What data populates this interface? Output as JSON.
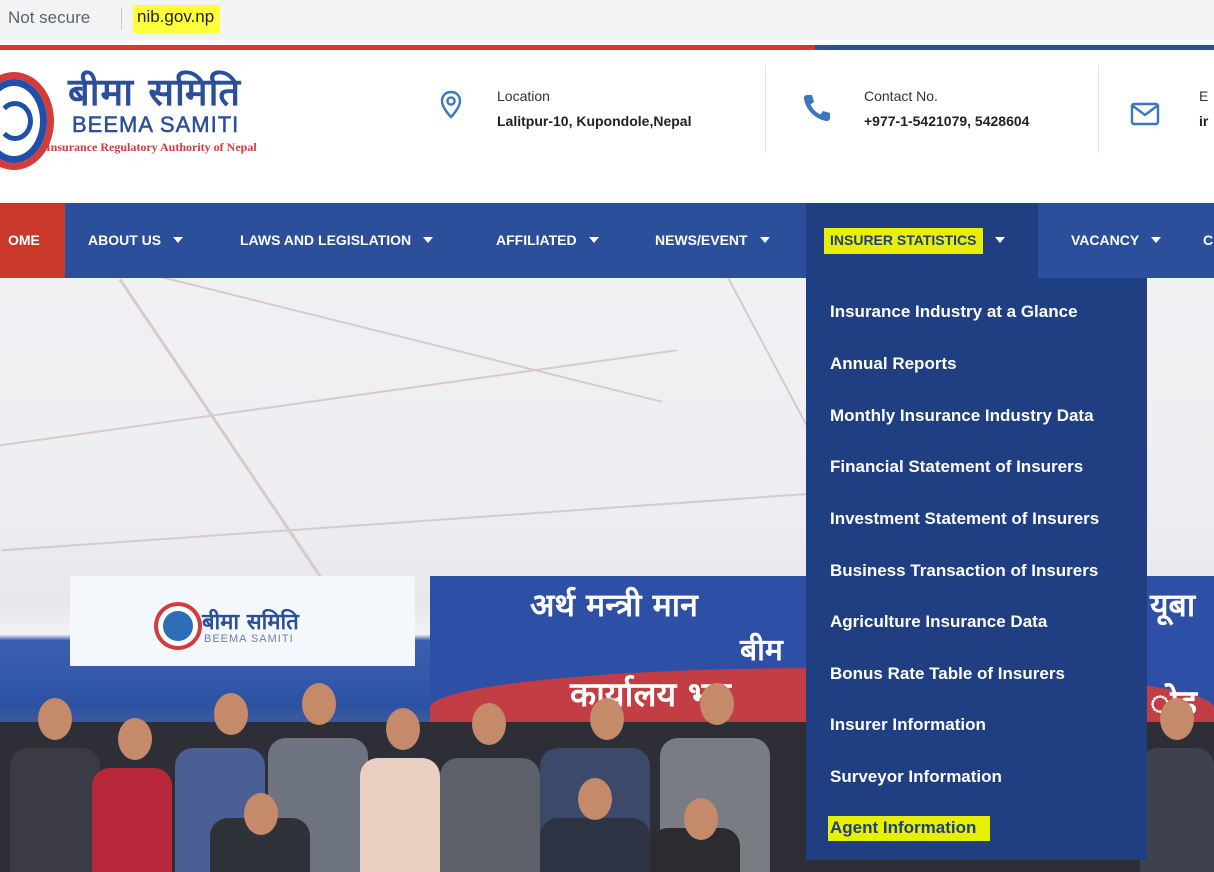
{
  "browser": {
    "security_label": "Not secure",
    "url": "nib.gov.np"
  },
  "header": {
    "logo": {
      "devanagari": "बीमा समिति",
      "latin": "BEEMA SAMITI",
      "tagline": "Insurance Regulatory Authority of Nepal"
    },
    "location": {
      "label": "Location",
      "value": "Lalitpur-10, Kupondole,Nepal"
    },
    "contact": {
      "label": "Contact No.",
      "value": "+977-1-5421079, 5428604"
    },
    "email": {
      "label": "E",
      "value": "ir"
    }
  },
  "nav": {
    "items": [
      {
        "label": "OME"
      },
      {
        "label": "ABOUT US"
      },
      {
        "label": "LAWS AND LEGISLATION"
      },
      {
        "label": "AFFILIATED"
      },
      {
        "label": "NEWS/EVENT"
      },
      {
        "label": "INSURER STATISTICS"
      },
      {
        "label": "VACANCY"
      },
      {
        "label": "C"
      }
    ]
  },
  "dropdown": {
    "items": [
      {
        "label": "Insurance Industry at a Glance"
      },
      {
        "label": "Annual Reports"
      },
      {
        "label": "Monthly Insurance Industry Data"
      },
      {
        "label": "Financial Statement of Insurers"
      },
      {
        "label": "Investment Statement of Insurers"
      },
      {
        "label": "Business Transaction of Insurers"
      },
      {
        "label": "Agriculture Insurance Data"
      },
      {
        "label": "Bonus Rate Table of Insurers"
      },
      {
        "label": "Insurer Information"
      },
      {
        "label": "Surveyor Information"
      },
      {
        "label": "Agent Information"
      }
    ]
  },
  "hero": {
    "mini_logo_devanagari": "बीमा समिति",
    "mini_logo_latin": "BEEMA SAMITI",
    "banner_line1": "अर्थ मन्त्री मान",
    "banner_line1_right": "यूबा",
    "banner_line2": "बीम",
    "banner_line3": "कार्यालय भव",
    "banner_line3_right": "ोह"
  },
  "colors": {
    "nav_blue": "#2c4f9b",
    "dropdown_blue": "#1f3f82",
    "home_red": "#c8392b",
    "highlight_yellow": "#e6f000"
  }
}
